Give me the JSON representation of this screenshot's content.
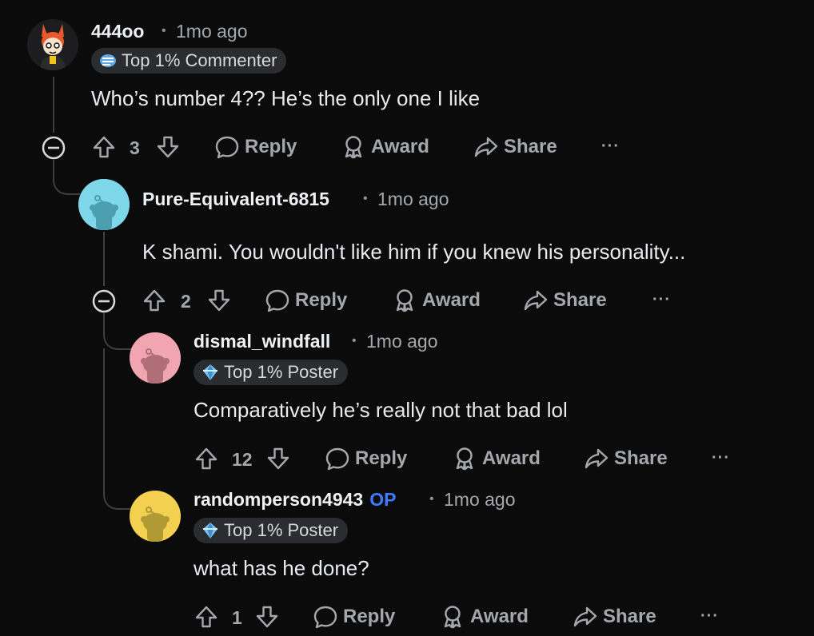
{
  "comments": [
    {
      "username": "444oo",
      "time": "1mo ago",
      "flair": "Top 1% Commenter",
      "body": "Who’s number 4?? He’s the only one I like",
      "votes": "3"
    },
    {
      "username": "Pure-Equivalent-6815",
      "time": "1mo ago",
      "body": "K shami. You wouldn't like him if you knew his personality...",
      "votes": "2"
    },
    {
      "username": "dismal_windfall",
      "time": "1mo ago",
      "flair": "Top 1% Poster",
      "body": "Comparatively he’s really not that bad lol",
      "votes": "12"
    },
    {
      "username": "randomperson4943",
      "op_badge": "OP",
      "time": "1mo ago",
      "flair": "Top 1% Poster",
      "body": "what has he done?",
      "votes": "1"
    }
  ],
  "actions": {
    "reply": "Reply",
    "award": "Award",
    "share": "Share",
    "more": "···"
  },
  "separator": "•",
  "colors": {
    "background": "#0b0b0c",
    "op": "#3d7bff",
    "avatar_cyan": "#7fd8ea",
    "avatar_pink": "#f0a5b0",
    "avatar_yellow": "#f3d04f"
  },
  "icons": [
    "upvote-icon",
    "downvote-icon",
    "reply-bubble-icon",
    "award-icon",
    "share-arrow-icon",
    "collapse-icon",
    "more-icon"
  ]
}
